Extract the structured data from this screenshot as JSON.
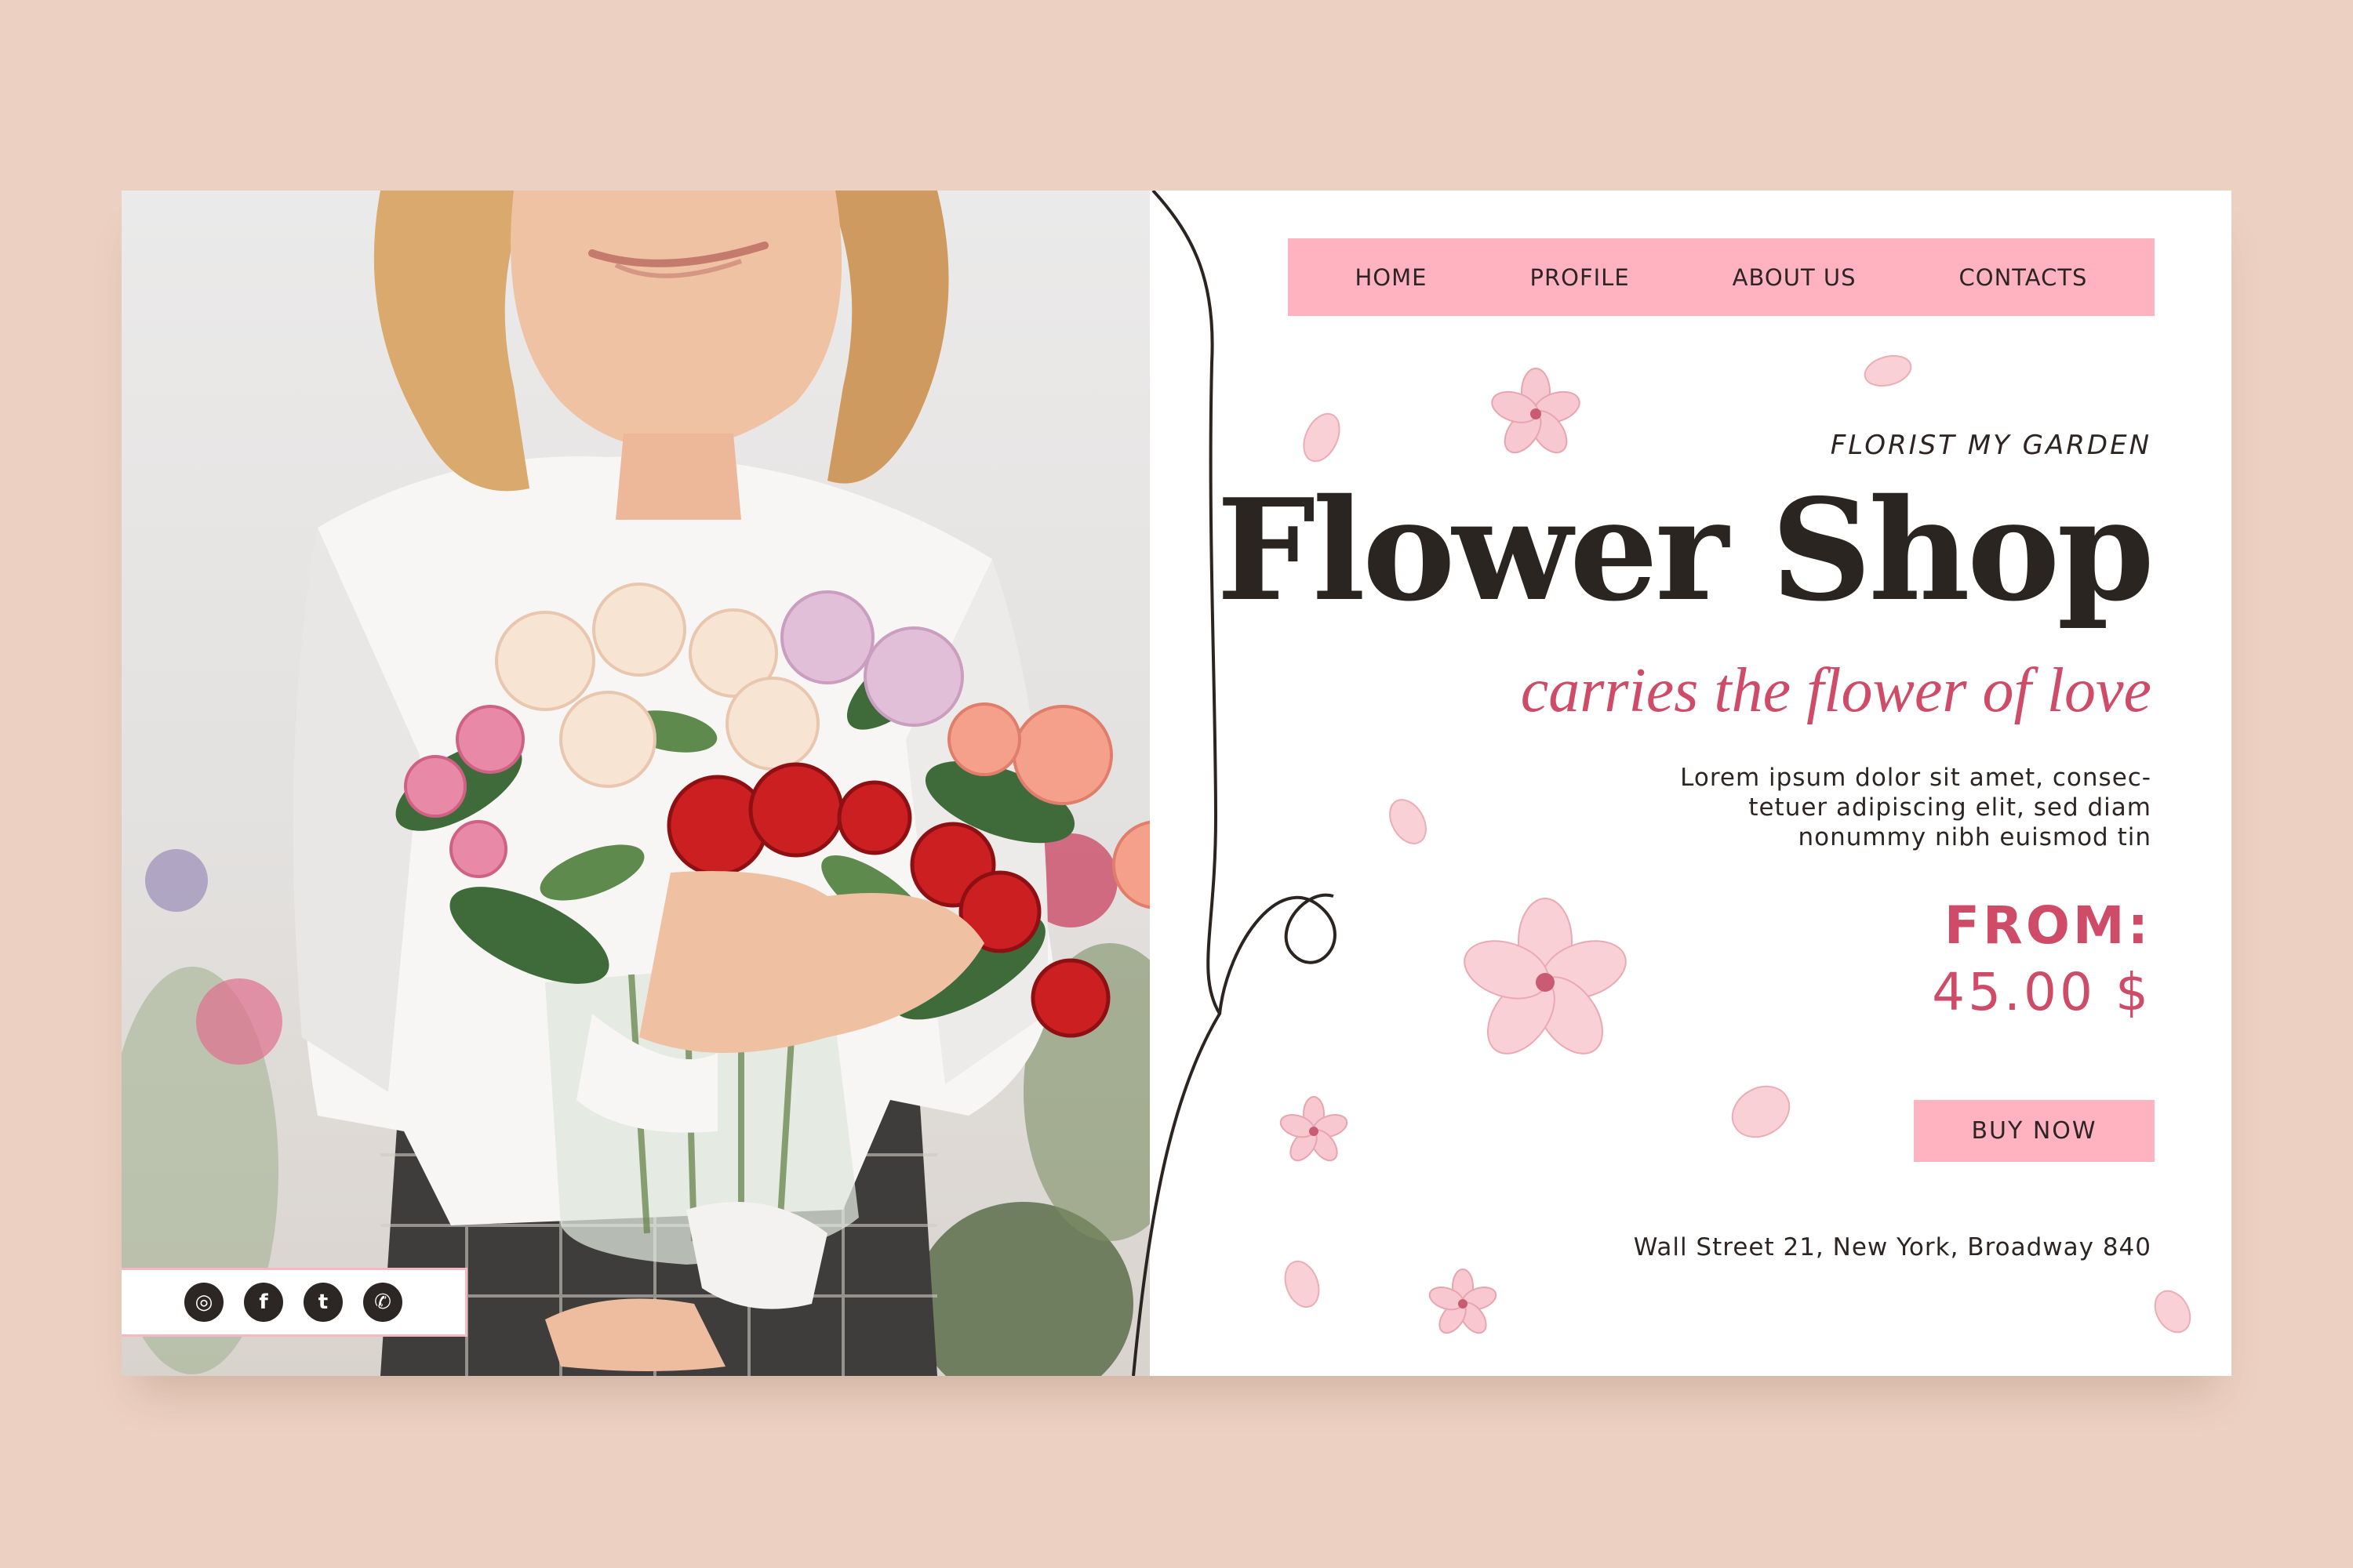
{
  "nav": {
    "items": [
      {
        "label": "HOME"
      },
      {
        "label": "PROFILE"
      },
      {
        "label": "ABOUT US"
      },
      {
        "label": "CONTACTS"
      }
    ]
  },
  "hero": {
    "overline": "FLORIST MY GARDEN",
    "title": "Flower Shop",
    "tagline": "carries the flower of love",
    "body": "Lorem ipsum dolor sit amet, consec-\ntetuer adipiscing elit, sed diam\nnonummy nibh euismod tin",
    "price_label": "FROM:",
    "price_value": "45.00 $",
    "cta_label": "BUY NOW",
    "address": "Wall Street 21, New York, Broadway 840"
  },
  "social": {
    "icons": [
      "instagram-icon",
      "facebook-icon",
      "twitter-icon",
      "whatsapp-icon"
    ]
  },
  "colors": {
    "background": "#ecd0c1",
    "accent_pink": "#ffb3c0",
    "title_dark": "#2b2522",
    "text_rose": "#cf4c68"
  }
}
